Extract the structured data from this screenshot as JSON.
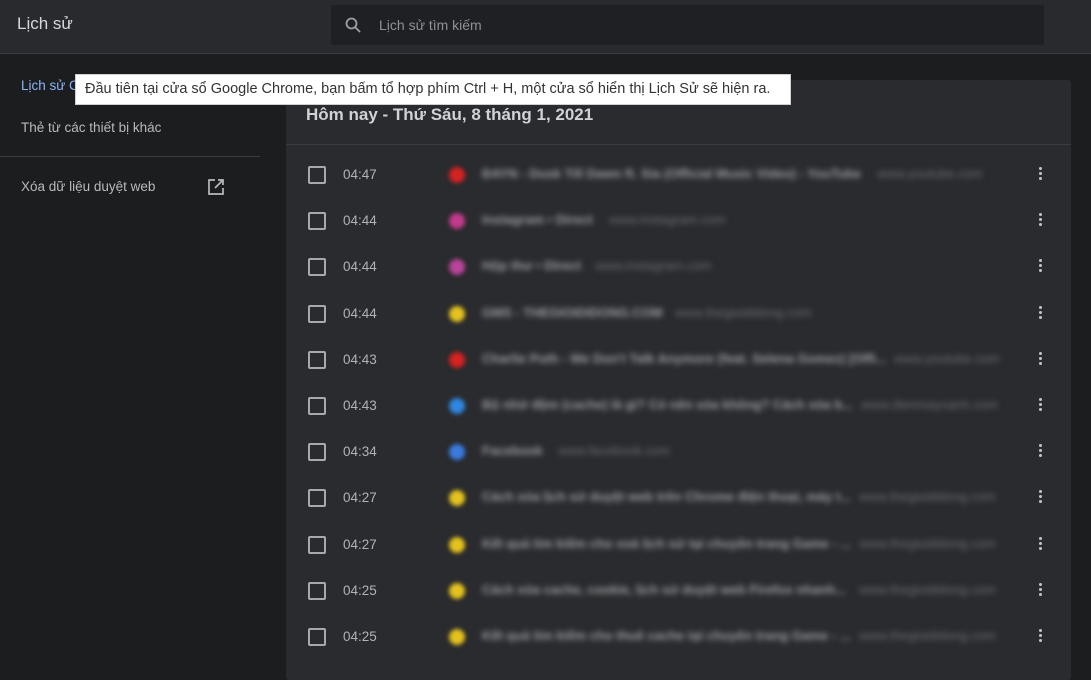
{
  "header": {
    "title": "Lịch sử",
    "search_placeholder": "Lịch sử tìm kiếm"
  },
  "sidebar": {
    "items": [
      {
        "label": "Lịch sử Chrome",
        "active": true
      },
      {
        "label": "Thẻ từ các thiết bị khác",
        "active": false
      }
    ],
    "clear_label": "Xóa dữ liệu duyệt web"
  },
  "tooltip": "Đầu tiên tại cửa sổ Google Chrome, bạn bấm tổ hợp phím Ctrl + H, một cửa sổ hiển thị Lịch Sử sẽ hiện ra.",
  "history": {
    "date_heading": "Hôm nay - Thứ Sáu, 8 tháng 1, 2021",
    "entries": [
      {
        "time": "04:47",
        "title": "ĐAYN - Dusk Till Dawn ft. Sia (Official Music Video) - YouTube",
        "url": "www.youtube.com",
        "favicon_color": "#d62222"
      },
      {
        "time": "04:44",
        "title": "Instagram • Direct",
        "url": "www.instagram.com",
        "favicon_color": "#c23a8a"
      },
      {
        "time": "04:44",
        "title": "Hộp thư • Direct",
        "url": "www.instagram.com",
        "favicon_color": "#b8449a"
      },
      {
        "time": "04:44",
        "title": "GMS - THEGIOIDIDONG.COM",
        "url": "www.thegioididong.com",
        "favicon_color": "#e4c21d"
      },
      {
        "time": "04:43",
        "title": "Charlie Puth - We Don't Talk Anymore (feat. Selena Gomez) [Offi...",
        "url": "www.youtube.com",
        "favicon_color": "#d62222"
      },
      {
        "time": "04:43",
        "title": "Bộ nhớ đệm (cache) là gì? Có nên xóa không? Cách xóa b...",
        "url": "www.dienmayxanh.com",
        "favicon_color": "#2f86e0"
      },
      {
        "time": "04:34",
        "title": "Facebook",
        "url": "www.facebook.com",
        "favicon_color": "#3a7be0"
      },
      {
        "time": "04:27",
        "title": "Cách xóa lịch sử duyệt web trên Chrome điện thoại, máy t...",
        "url": "www.thegioididong.com",
        "favicon_color": "#e4c21d"
      },
      {
        "time": "04:27",
        "title": "Kết quả tìm kiếm cho xoá lịch sử tại chuyên trang Game - ...",
        "url": "www.thegioididong.com",
        "favicon_color": "#e4c21d"
      },
      {
        "time": "04:25",
        "title": "Cách xóa cache, cookie, lịch sử duyệt web Firefox nhanh...",
        "url": "www.thegioididong.com",
        "favicon_color": "#e4c21d"
      },
      {
        "time": "04:25",
        "title": "Kết quả tìm kiếm cho thuê cache tại chuyên trang Game - ...",
        "url": "www.thegioididong.com",
        "favicon_color": "#e4c21d"
      }
    ]
  }
}
